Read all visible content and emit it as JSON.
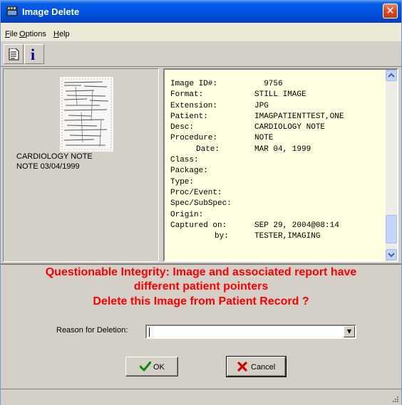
{
  "window": {
    "title": "Image Delete",
    "icon": "film-strip-icon",
    "close_icon": "close-icon"
  },
  "menu": {
    "file": "File",
    "options": "Options",
    "help": "Help"
  },
  "toolbar": {
    "report_icon": "document-icon",
    "info_icon": "info-icon",
    "info_glyph": "i"
  },
  "thumbnail": {
    "caption_line1": "CARDIOLOGY NOTE",
    "caption_line2": "NOTE 03/04/1999"
  },
  "info": {
    "rows": [
      {
        "key": "Image ID#:",
        "value": "  9756"
      },
      {
        "key": "Format:",
        "value": "STILL IMAGE"
      },
      {
        "key": "Extension:",
        "value": "JPG"
      },
      {
        "key": "Patient:",
        "value": "IMAGPATIENTTEST,ONE"
      },
      {
        "key": "Desc:",
        "value": "CARDIOLOGY NOTE"
      },
      {
        "key": "Procedure:",
        "value": "NOTE"
      },
      {
        "key": "Date:",
        "value": "MAR 04, 1999"
      },
      {
        "key": "Class:",
        "value": ""
      },
      {
        "key": "Package:",
        "value": ""
      },
      {
        "key": "Type:",
        "value": ""
      },
      {
        "key": "Proc/Event:",
        "value": ""
      },
      {
        "key": "Spec/SubSpec:",
        "value": ""
      },
      {
        "key": "Origin:",
        "value": ""
      },
      {
        "key": "Captured on:",
        "value": "SEP 29, 2004@08:14"
      },
      {
        "key": "by:",
        "value": "TESTER,IMAGING"
      }
    ]
  },
  "warning": {
    "line1": "Questionable Integrity: Image and associated report have",
    "line2": "different patient pointers",
    "line3": "Delete this Image from Patient Record ?",
    "color": "#ff0000"
  },
  "reason": {
    "label": "Reason for Deletion:",
    "value": ""
  },
  "buttons": {
    "ok": "OK",
    "cancel": "Cancel",
    "ok_icon": "checkmark-icon",
    "cancel_icon": "x-icon"
  }
}
